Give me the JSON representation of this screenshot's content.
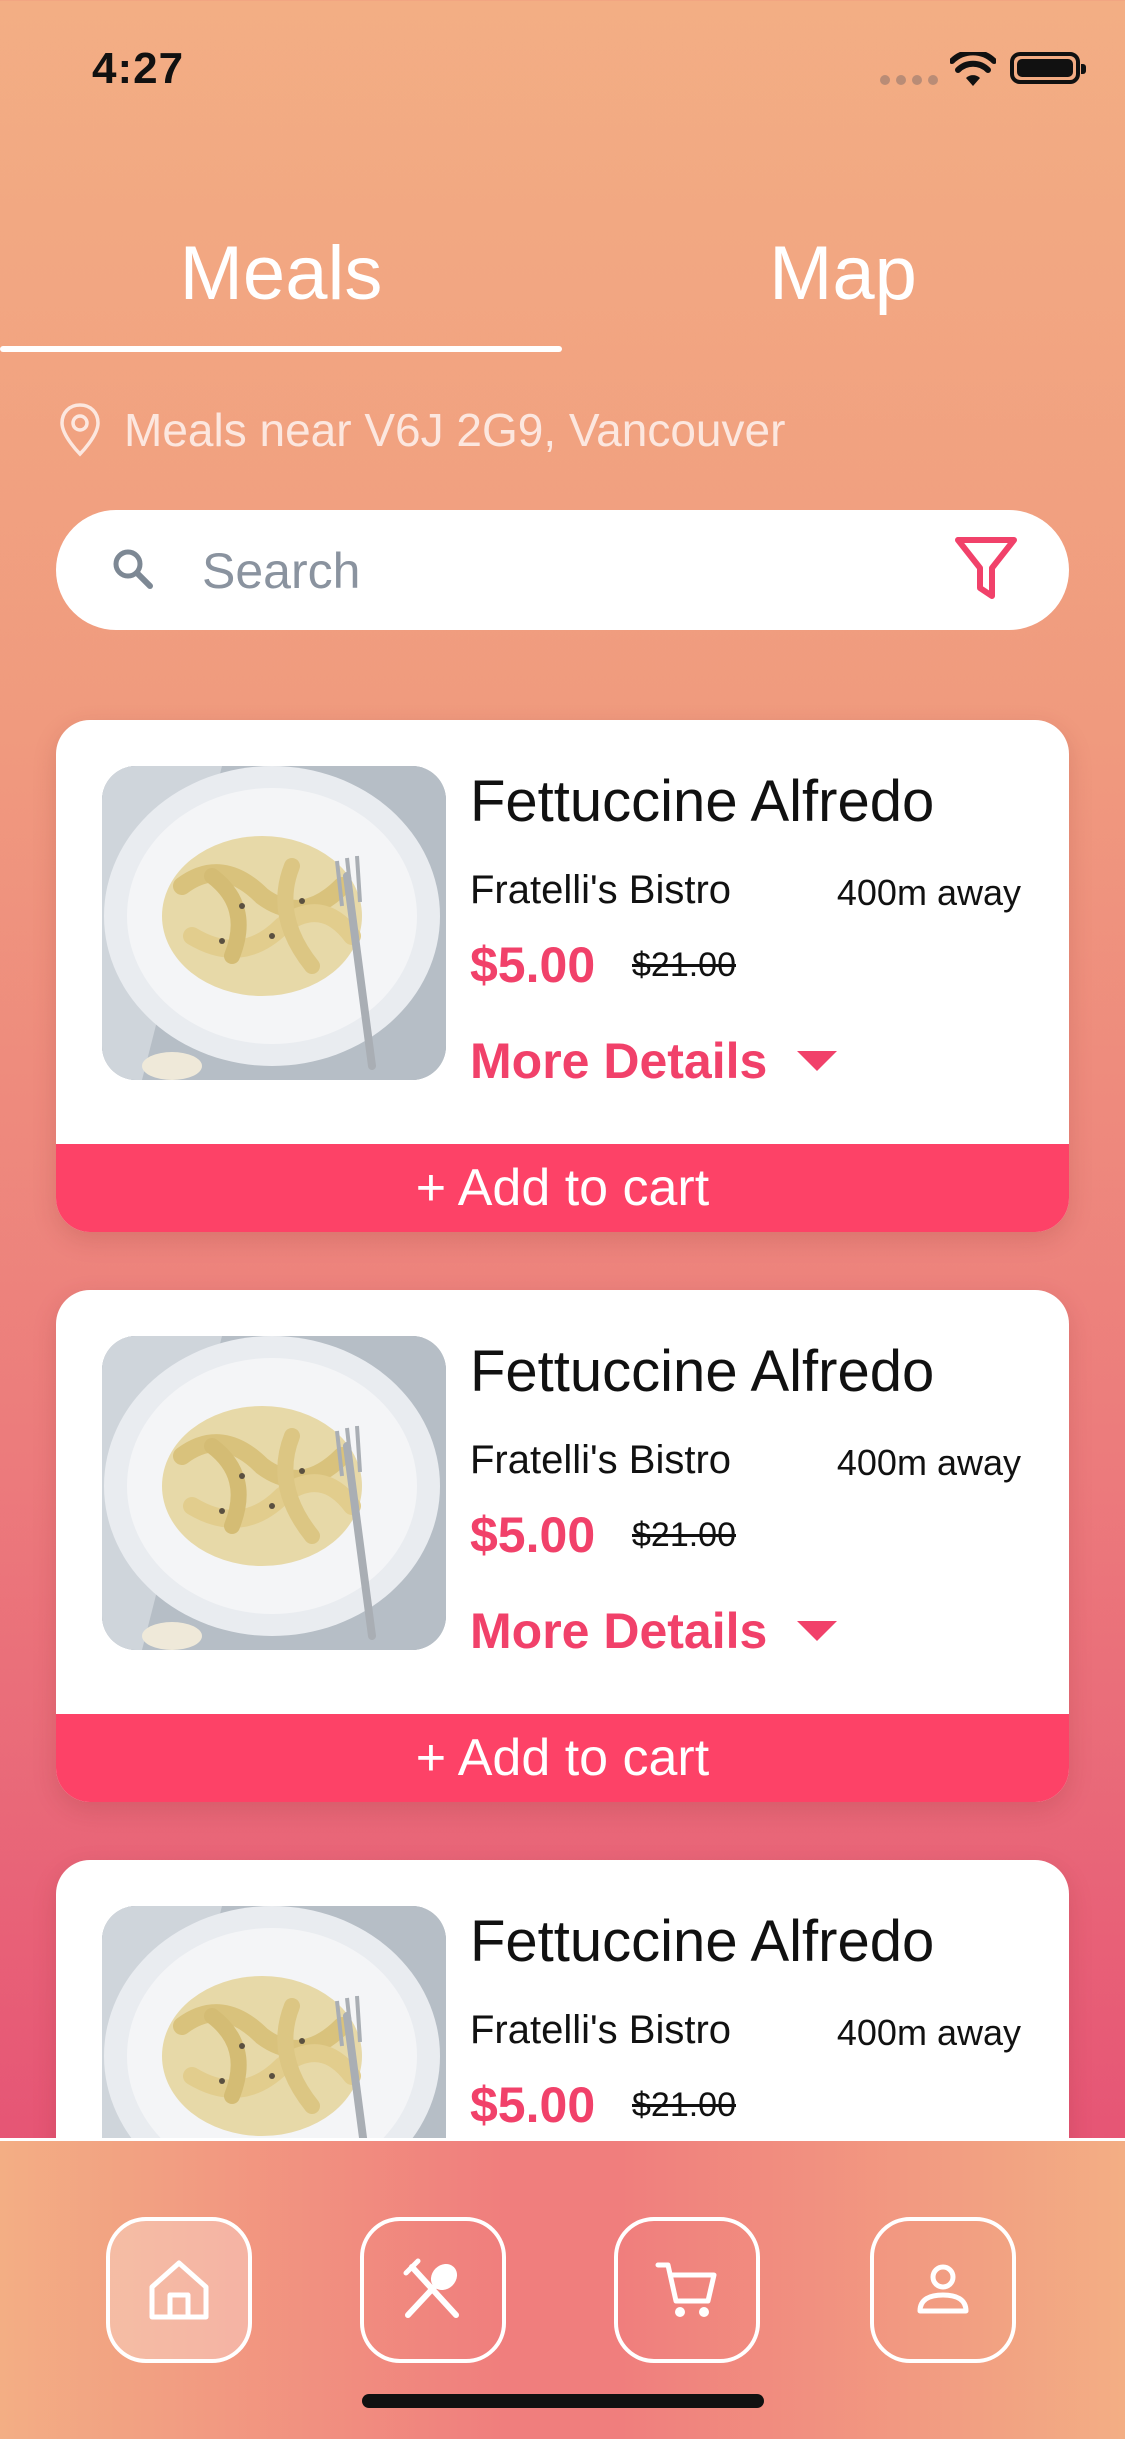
{
  "status": {
    "time": "4:27"
  },
  "tabs": [
    {
      "label": "Meals",
      "active": true
    },
    {
      "label": "Map",
      "active": false
    }
  ],
  "location": {
    "text": "Meals near V6J 2G9, Vancouver",
    "icon": "map-pin-icon"
  },
  "search": {
    "placeholder": "Search",
    "icon": "search-icon",
    "filter_icon": "filter-icon"
  },
  "meals": [
    {
      "title": "Fettuccine Alfredo",
      "vendor": "Fratelli's Bistro",
      "distance": "400m away",
      "price": "$5.00",
      "old_price": "$21.00",
      "details_label": "More Details",
      "cart_label": "+ Add to cart"
    },
    {
      "title": "Fettuccine Alfredo",
      "vendor": "Fratelli's Bistro",
      "distance": "400m away",
      "price": "$5.00",
      "old_price": "$21.00",
      "details_label": "More Details",
      "cart_label": "+ Add to cart"
    },
    {
      "title": "Fettuccine Alfredo",
      "vendor": "Fratelli's Bistro",
      "distance": "400m away",
      "price": "$5.00",
      "old_price": "$21.00"
    }
  ],
  "nav": [
    {
      "icon": "home-icon",
      "active": true
    },
    {
      "icon": "utensils-icon",
      "active": false
    },
    {
      "icon": "cart-icon",
      "active": false
    },
    {
      "icon": "user-icon",
      "active": false
    }
  ],
  "colors": {
    "accent": "#F1416A",
    "cart_bar": "#FD4267",
    "bg_top": "#F3AE84",
    "bg_bottom": "#E24E72"
  }
}
